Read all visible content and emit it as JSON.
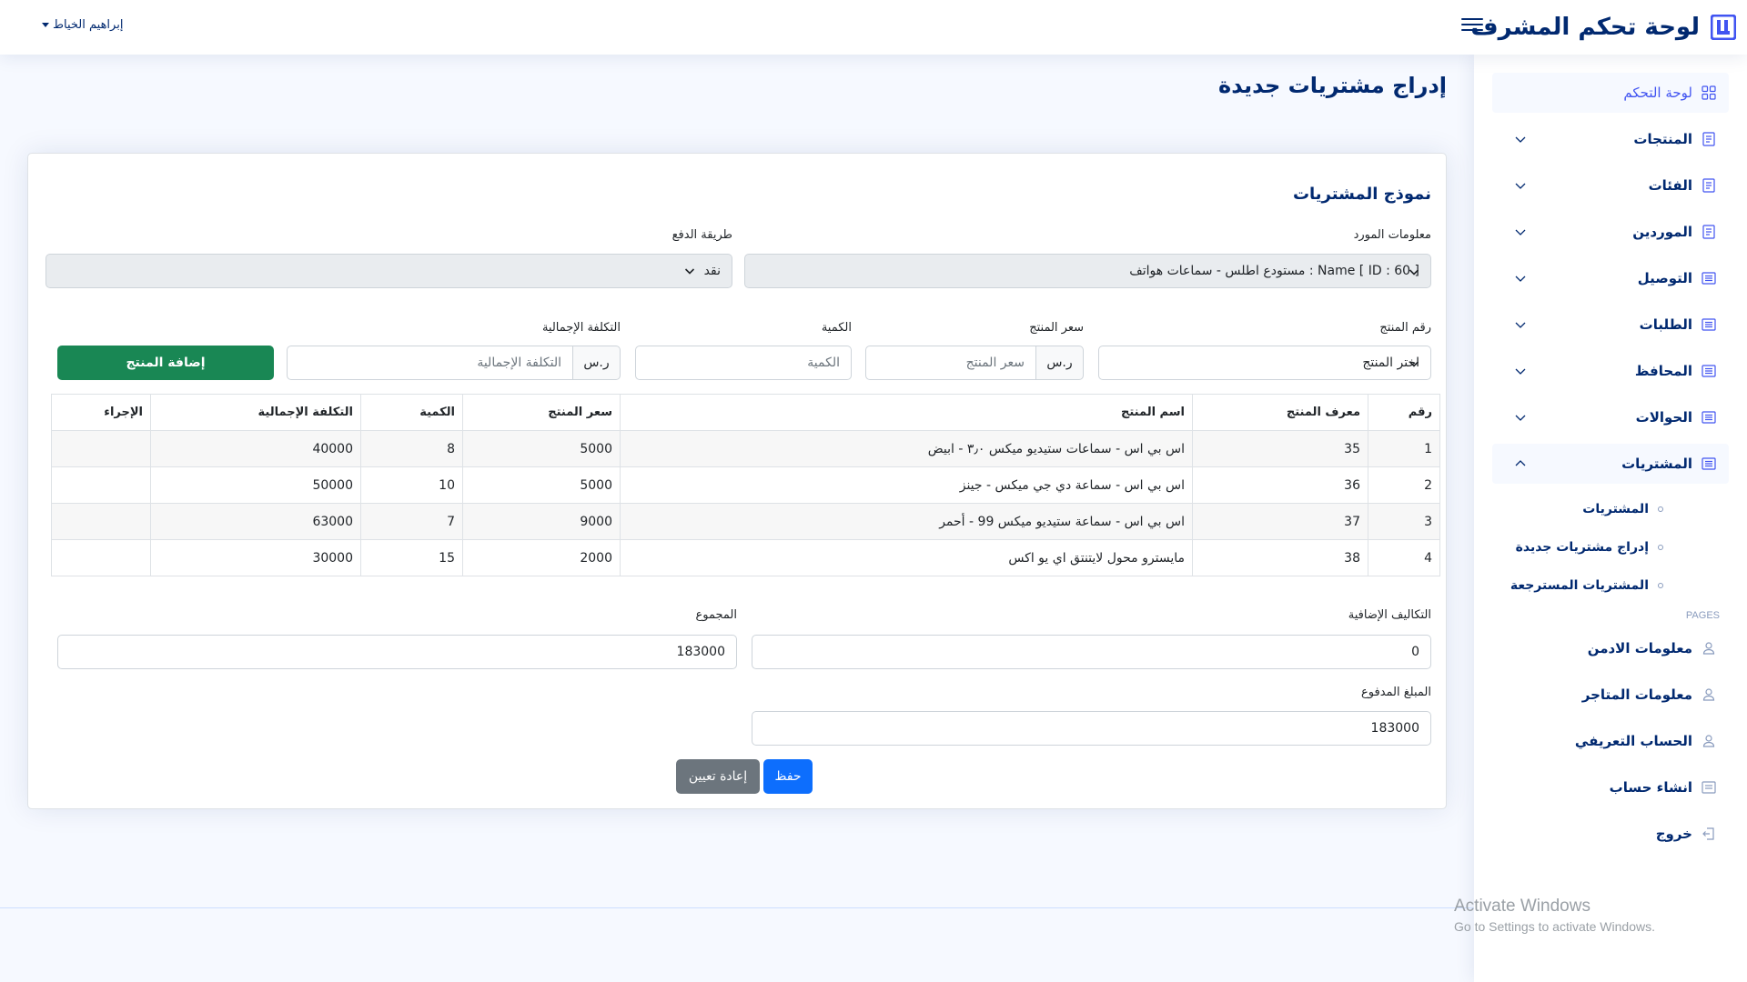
{
  "header": {
    "app_title": "لوحة تحكم المشرف",
    "user_name": "إبراهيم الخياط"
  },
  "sidebar": {
    "items": [
      {
        "label": "لوحة التحكم",
        "icon": "grid-icon"
      },
      {
        "label": "المنتجات",
        "icon": "journal-icon"
      },
      {
        "label": "الفئات",
        "icon": "journal-icon"
      },
      {
        "label": "الموردين",
        "icon": "journal-icon"
      },
      {
        "label": "التوصيل",
        "icon": "list-icon"
      },
      {
        "label": "الطلبات",
        "icon": "list-icon"
      },
      {
        "label": "المحافظ",
        "icon": "list-icon"
      },
      {
        "label": "الحوالات",
        "icon": "list-icon"
      },
      {
        "label": "المشتريات",
        "icon": "list-icon"
      }
    ],
    "sub_items": [
      "المشتريات",
      "إدراج مشتريات جديدة",
      "المشتريات المسترجعة"
    ],
    "pages_heading": "PAGES",
    "pages": [
      {
        "label": "معلومات الادمن",
        "icon": "person-icon"
      },
      {
        "label": "معلومات المتاجر",
        "icon": "person-icon"
      },
      {
        "label": "الحساب التعريفي",
        "icon": "person-icon"
      },
      {
        "label": "انشاء حساب",
        "icon": "card-icon"
      },
      {
        "label": "خروج",
        "icon": "logout-icon"
      }
    ]
  },
  "page": {
    "title": "إدراج مشتريات جديدة"
  },
  "form": {
    "card_title": "نموذج المشتريات",
    "supplier_label": "معلومات المورد",
    "supplier_value": "[ ID : 60 ] Name : مستودع اطلس - سماعات هواتف",
    "payment_label": "طريقة الدفع",
    "payment_value": "نقد",
    "product_no_label": "رقم المنتج",
    "product_select_placeholder": "اختر المنتج",
    "price_label": "سعر المنتج",
    "price_placeholder": "سعر المنتج",
    "currency": "ر.س",
    "qty_label": "الكمية",
    "qty_placeholder": "الكمية",
    "total_cost_label": "التكلفة الإجمالية",
    "total_cost_placeholder": "التكلفة الإجمالية",
    "add_button": "إضافة المنتج",
    "extra_costs_label": "التكاليف الإضافية",
    "extra_costs_value": "0",
    "sum_label": "المجموع",
    "sum_value": "183000",
    "paid_label": "المبلغ المدفوع",
    "paid_value": "183000",
    "save_button": "حفظ",
    "reset_button": "إعادة تعيين"
  },
  "table": {
    "headers": [
      "رقم",
      "معرف المنتج",
      "اسم المنتج",
      "سعر المنتج",
      "الكمية",
      "التكلفة الإجمالية",
      "الإجراء"
    ],
    "rows": [
      [
        "1",
        "35",
        "اس بي اس - سماعات ستيديو ميكس ٣٫٠ - ابيض",
        "5000",
        "8",
        "40000",
        ""
      ],
      [
        "2",
        "36",
        "اس بي اس - سماعة دي جي ميكس - جينز",
        "5000",
        "10",
        "50000",
        ""
      ],
      [
        "3",
        "37",
        "اس بي اس - سماعة ستيديو ميكس 99 - أحمر",
        "9000",
        "7",
        "63000",
        ""
      ],
      [
        "4",
        "38",
        "مايسترو محول لايتنتق اي يو اكس",
        "2000",
        "15",
        "30000",
        ""
      ]
    ]
  },
  "watermark": {
    "line1": "Activate Windows",
    "line2": "Go to Settings to activate Windows."
  }
}
